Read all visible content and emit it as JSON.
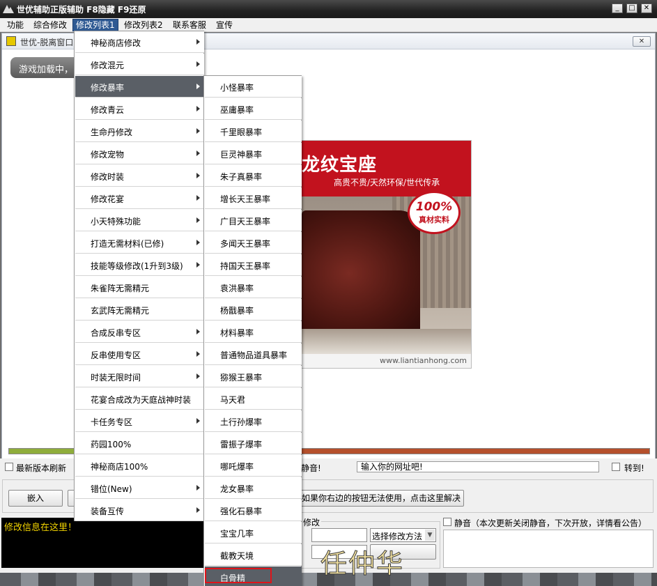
{
  "window": {
    "title": "世优辅助正版辅助  F8隐藏  F9还原",
    "buttons": [
      "_",
      "□",
      "✕"
    ]
  },
  "menubar": [
    "功能",
    "综合修改",
    "修改列表1",
    "修改列表2",
    "联系客服",
    "宣传"
  ],
  "client": {
    "title": "世优-脱离窗口",
    "loading": "游戏加载中，"
  },
  "ad": {
    "title": "龙纹宝座",
    "subtitle": "高贵不贵/天然环保/世代传承",
    "badge_big": "100%",
    "badge_small": "真材实料",
    "url": "www.liantianhong.com"
  },
  "progress": {
    "fraction": 0.45
  },
  "bottom": {
    "refresh_label": "最新版本刷新",
    "mute_label": "静音!",
    "url_placeholder": "输入你的网址吧!",
    "goto_label": "转到!",
    "embed_button": "嵌入",
    "fix_button": "如果你右边的按钮无法使用，点击这里解决",
    "info_text": "修改信息在这里！",
    "modify_group": "修改",
    "select_method": "选择修改方法",
    "notice_label": "静音（本次更新关闭静音，下次开放，详情看公告）",
    "watermark": "任仲华"
  },
  "menu1": [
    {
      "label": "神秘商店修改",
      "sub": true
    },
    {
      "label": "修改混元",
      "sub": true
    },
    {
      "label": "修改暴率",
      "sub": true,
      "highlight": true
    },
    {
      "label": "修改青云",
      "sub": true
    },
    {
      "label": "生命丹修改",
      "sub": true
    },
    {
      "label": "修改宠物",
      "sub": true
    },
    {
      "label": "修改时装",
      "sub": true
    },
    {
      "label": "修改花宴",
      "sub": true
    },
    {
      "label": "小天特殊功能",
      "sub": true
    },
    {
      "label": "打造无需材料(已修)",
      "sub": true
    },
    {
      "label": "技能等级修改(1升到3级)",
      "sub": true
    },
    {
      "label": "朱雀阵无需精元",
      "sub": false
    },
    {
      "label": "玄武阵无需精元",
      "sub": false
    },
    {
      "label": "合成反串专区",
      "sub": true
    },
    {
      "label": "反串使用专区",
      "sub": true
    },
    {
      "label": "时装无限时间",
      "sub": true
    },
    {
      "label": "花宴合成改为天庭战神时装",
      "sub": false
    },
    {
      "label": "卡任务专区",
      "sub": true
    },
    {
      "label": "药园100%",
      "sub": false
    },
    {
      "label": "神秘商店100%",
      "sub": false
    },
    {
      "label": "错位(New)",
      "sub": true
    },
    {
      "label": "装备互传",
      "sub": true
    }
  ],
  "menu2": [
    {
      "label": "小怪暴率"
    },
    {
      "label": "巫庸暴率"
    },
    {
      "label": "千里眼暴率"
    },
    {
      "label": "巨灵神暴率"
    },
    {
      "label": "朱子真暴率"
    },
    {
      "label": "增长天王暴率"
    },
    {
      "label": "广目天王暴率"
    },
    {
      "label": "多闻天王暴率"
    },
    {
      "label": "持国天王暴率"
    },
    {
      "label": "袁洪暴率"
    },
    {
      "label": "杨戬暴率"
    },
    {
      "label": "材料暴率"
    },
    {
      "label": "普通物品道具暴率"
    },
    {
      "label": "猕猴王暴率"
    },
    {
      "label": "马天君"
    },
    {
      "label": "土行孙爆率"
    },
    {
      "label": "雷振子爆率"
    },
    {
      "label": "哪吒爆率"
    },
    {
      "label": "龙女暴率"
    },
    {
      "label": "强化石暴率"
    },
    {
      "label": "宝宝几率"
    },
    {
      "label": "截教天境"
    },
    {
      "label": "白骨精",
      "highlight": true
    }
  ]
}
